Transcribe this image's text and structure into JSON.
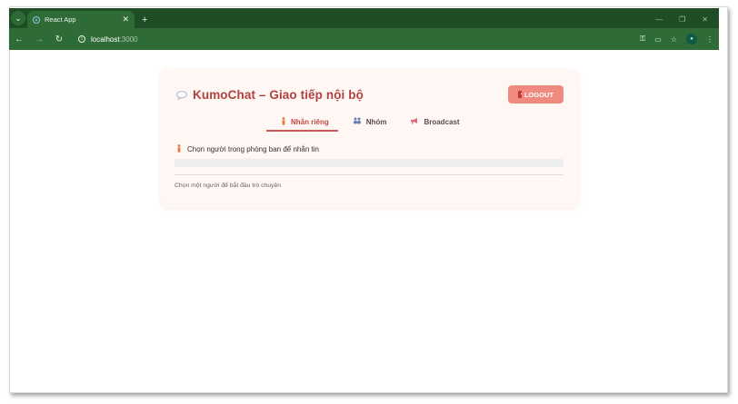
{
  "browser": {
    "tab_title": "React App",
    "url_host": "localhost",
    "url_port": ":3000"
  },
  "app": {
    "title": "KumoChat – Giao tiếp nội bộ",
    "logout_label": "LOGOUT",
    "tabs": [
      {
        "label": "Nhắn riêng",
        "icon": "person-icon",
        "active": true
      },
      {
        "label": "Nhóm",
        "icon": "group-icon",
        "active": false
      },
      {
        "label": "Broadcast",
        "icon": "megaphone-icon",
        "active": false
      }
    ],
    "prompt": "Chọn người trong phòng ban để nhắn tin",
    "hint": "Chọn một người để bắt đầu trò chuyện"
  },
  "colors": {
    "browser_frame": "#1e4d26",
    "browser_toolbar": "#2f6b37",
    "title": "#b0413e",
    "logout_bg": "#ef8a80",
    "card_bg": "#fff7f4",
    "active_tab": "#c65a52"
  }
}
